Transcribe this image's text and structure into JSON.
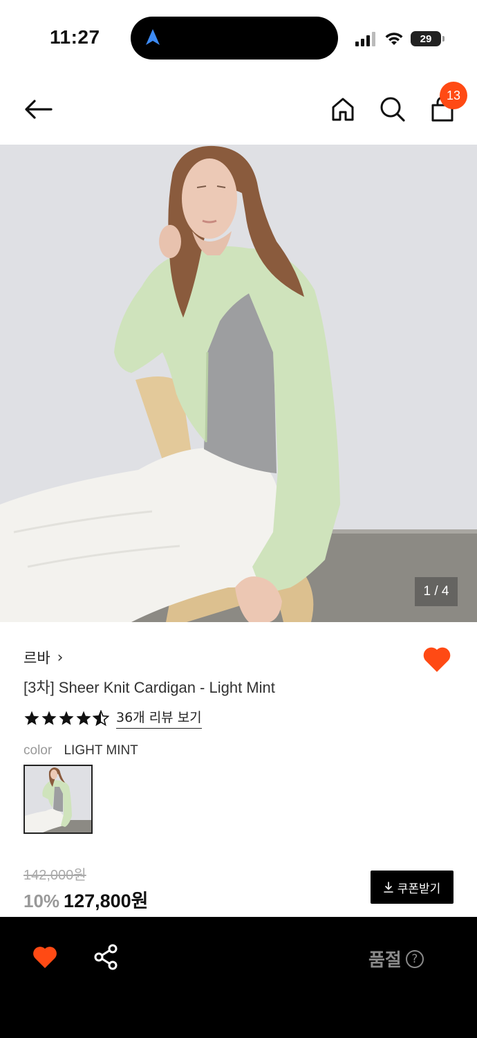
{
  "status_bar": {
    "time": "11:27",
    "battery": "29"
  },
  "header": {
    "cart_count": "13",
    "icons": [
      "back-arrow-icon",
      "home-icon",
      "search-icon",
      "shopping-bag-icon"
    ]
  },
  "gallery": {
    "counter": "1 / 4",
    "current": 1,
    "total": 4
  },
  "product": {
    "brand": "르바",
    "brand_chevron": "›",
    "title": "[3차] Sheer Knit Cardigan - Light Mint",
    "rating": 4.5,
    "review_link": "36개 리뷰 보기",
    "color_label": "color",
    "color_value": "LIGHT MINT",
    "original_price": "142,000원",
    "discount": "10%",
    "sale_price": "127,800원",
    "coupon_button": "쿠폰받기",
    "wishlisted": true
  },
  "bottom_bar": {
    "status": "품절",
    "help": "?"
  },
  "colors": {
    "accent": "#ff4a14",
    "badge": "#ff4a14",
    "bottom_bar_bg": "#000000",
    "soldout_text": "#8a8a8a"
  }
}
